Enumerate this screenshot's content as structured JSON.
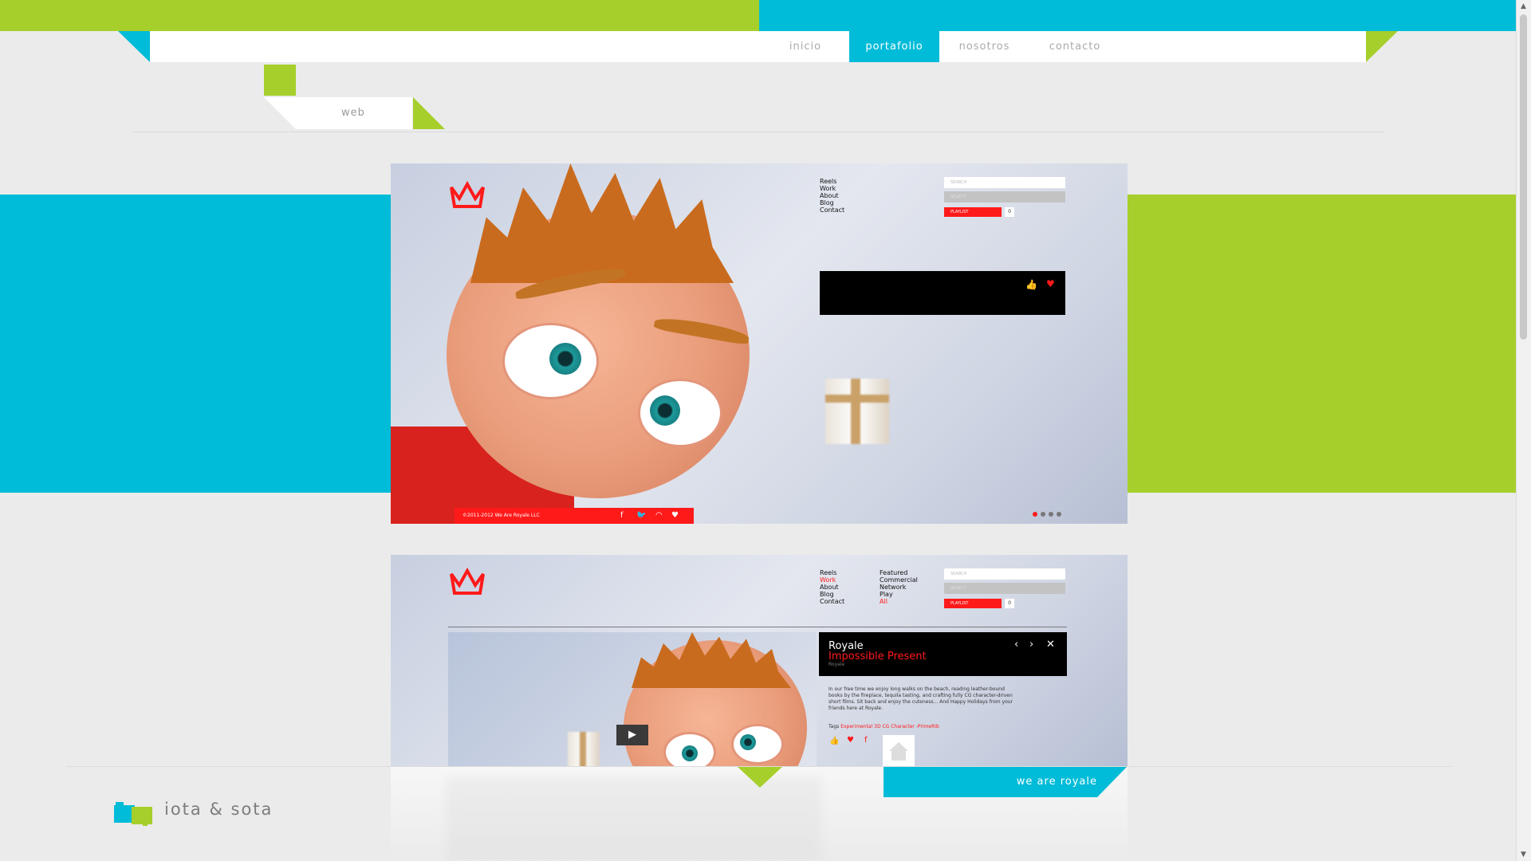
{
  "nav": {
    "items": [
      "inicio",
      "portafolio",
      "nosotros",
      "contacto"
    ],
    "active": "portafolio"
  },
  "section": {
    "tab_label": "web"
  },
  "site_preview": {
    "menu": [
      "Reels",
      "Work",
      "About",
      "Blog",
      "Contact"
    ],
    "search_placeholder": "SEARCH",
    "select_label": "SELECT",
    "playlist_label": "PLAYLIST",
    "playlist_count": "0",
    "copyright": "©2011-2012 We Are Royale LLC",
    "slides_total": 4,
    "slide_active": 1
  },
  "site_preview_work": {
    "menu": [
      "Reels",
      "Work",
      "About",
      "Blog",
      "Contact"
    ],
    "submenu": [
      "Featured",
      "Commercial",
      "Network",
      "Play",
      "All"
    ],
    "search_placeholder": "SEARCH",
    "select_label": "SELECT",
    "playlist_label": "PLAYLIST",
    "playlist_count": "0",
    "detail": {
      "title": "Royale",
      "subtitle": "Impossible Present",
      "client": "Royale",
      "description": "In our free time we enjoy long walks on the beach, reading leather-bound books by the fireplace, tequila tasting, and crafting fully CG character-driven short films. Sit back and enjoy the cuteness... And Happy Holidays from your friends here at Royale.",
      "tags_label": "Tags",
      "tags": "Experimental 3D CG Character -PrimeRib"
    }
  },
  "footer": {
    "brand": "iota & sota",
    "tagline": "we are royale"
  },
  "colors": {
    "green": "#a6cf2b",
    "blue": "#00bcd8",
    "red": "#ff1a1a"
  }
}
